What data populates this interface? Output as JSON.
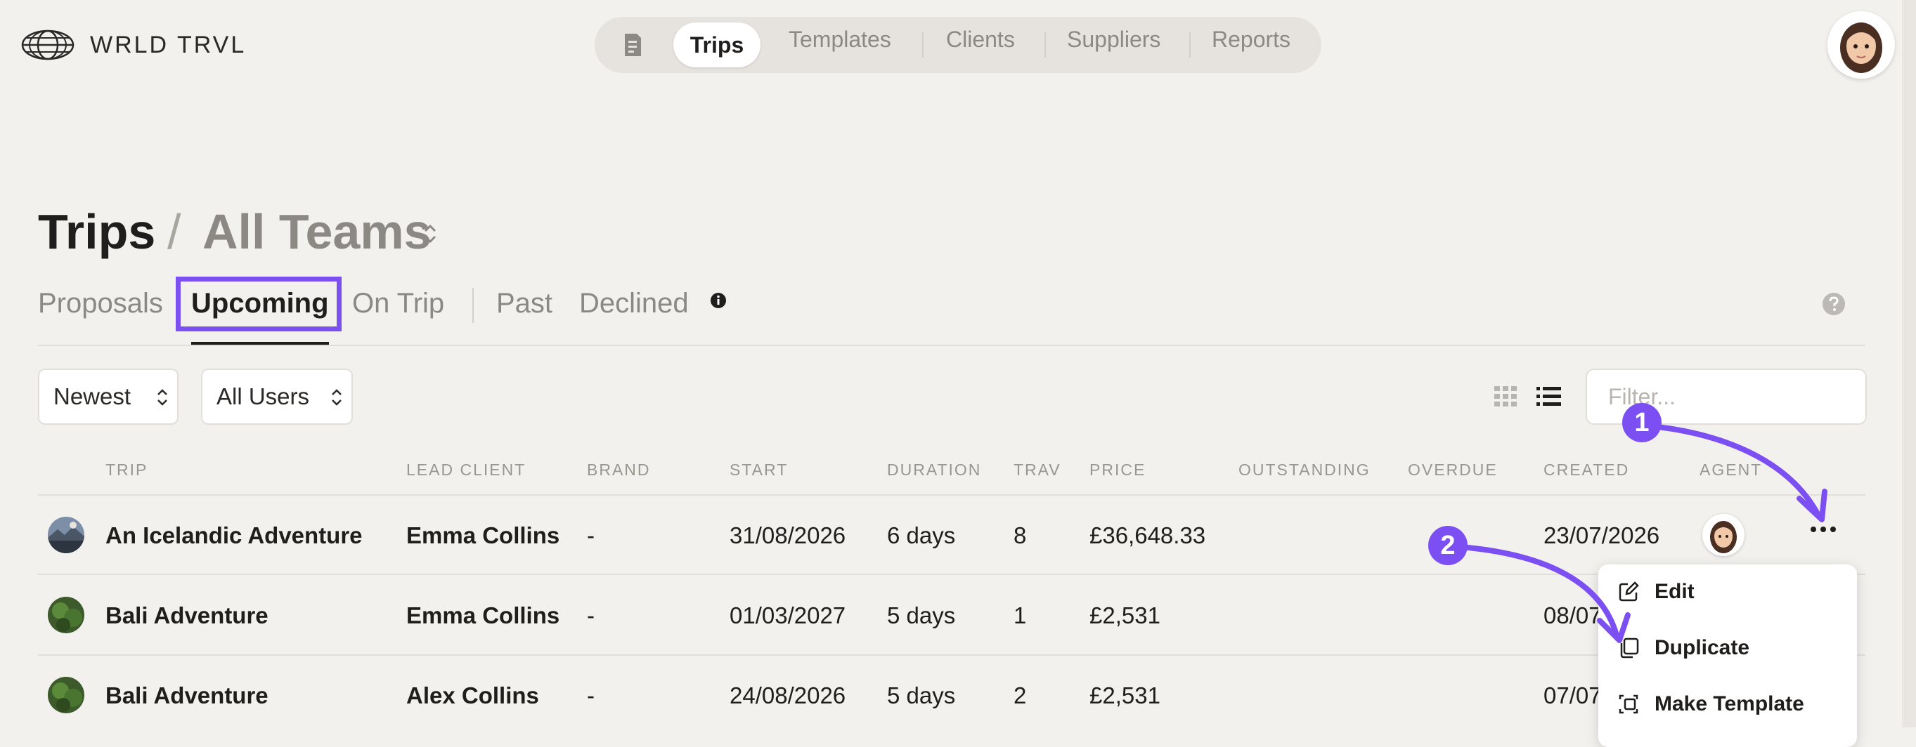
{
  "app": {
    "brand": "WRLD TRVL"
  },
  "nav": {
    "items": [
      "Trips",
      "Templates",
      "Clients",
      "Suppliers",
      "Reports"
    ],
    "active": "Trips"
  },
  "page": {
    "title": "Trips",
    "separator": "/",
    "team": "All Teams"
  },
  "tabs": [
    "Proposals",
    "Upcoming",
    "On Trip",
    "Past",
    "Declined"
  ],
  "controls": {
    "sort": "Newest",
    "users": "All Users",
    "filter_placeholder": "Filter..."
  },
  "table": {
    "headers": [
      "TRIP",
      "LEAD CLIENT",
      "BRAND",
      "START",
      "DURATION",
      "TRAV",
      "PRICE",
      "OUTSTANDING",
      "OVERDUE",
      "CREATED",
      "AGENT"
    ],
    "rows": [
      {
        "trip": "An Icelandic Adventure",
        "lead_client": "Emma Collins",
        "brand": "-",
        "start": "31/08/2026",
        "duration": "6 days",
        "trav": "8",
        "price": "£36,648.33",
        "created": "23/07/2026"
      },
      {
        "trip": "Bali Adventure",
        "lead_client": "Emma Collins",
        "brand": "-",
        "start": "01/03/2027",
        "duration": "5 days",
        "trav": "1",
        "price": "£2,531",
        "created": "08/07"
      },
      {
        "trip": "Bali Adventure",
        "lead_client": "Alex Collins",
        "brand": "-",
        "start": "24/08/2026",
        "duration": "5 days",
        "trav": "2",
        "price": "£2,531",
        "created": "07/07"
      }
    ]
  },
  "menu": {
    "items": [
      "Edit",
      "Duplicate",
      "Make Template"
    ]
  },
  "annotations": {
    "step1": "1",
    "step2": "2"
  },
  "colors": {
    "accent": "#7b4ff2",
    "background": "#f3f1ee"
  },
  "icons": [
    "globe-icon",
    "document-icon",
    "sort-icon",
    "info-icon",
    "help-icon",
    "grid-view-icon",
    "list-view-icon",
    "more-icon",
    "edit-icon",
    "duplicate-icon",
    "template-icon"
  ]
}
